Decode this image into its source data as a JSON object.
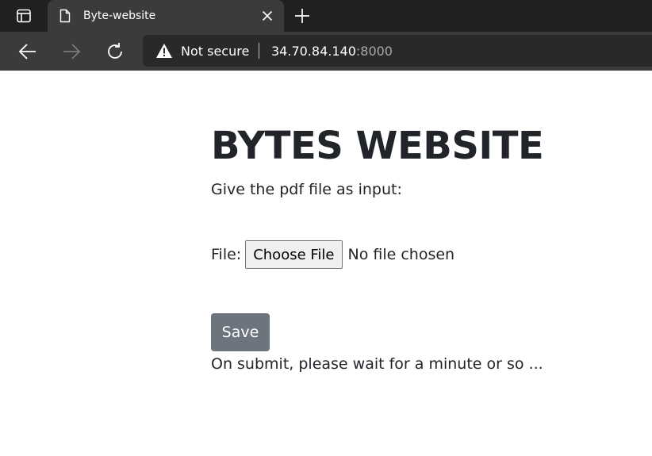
{
  "browser": {
    "tab": {
      "title": "Byte-website"
    },
    "address_bar": {
      "security_label": "Not secure",
      "host": "34.70.84.140",
      "port": ":8000"
    }
  },
  "page": {
    "title": "BYTES WEBSITE",
    "instructions": "Give the pdf file as input:",
    "file_field": {
      "label": "File:",
      "button_label": "Choose File",
      "status": "No file chosen"
    },
    "save_label": "Save",
    "submit_note": "On submit, please wait for a minute or so ..."
  },
  "icons": {
    "tab_actions": "tab-actions-icon",
    "page": "page-icon",
    "close": "close-icon",
    "new_tab": "plus-icon",
    "back": "arrow-left-icon",
    "forward": "arrow-right-icon",
    "reload": "reload-icon",
    "warning": "warning-triangle-icon"
  },
  "colors": {
    "tabbar_bg": "#202020",
    "toolbar_bg": "#3b3b3b",
    "save_button_bg": "#6c757d",
    "text": "#212529"
  }
}
